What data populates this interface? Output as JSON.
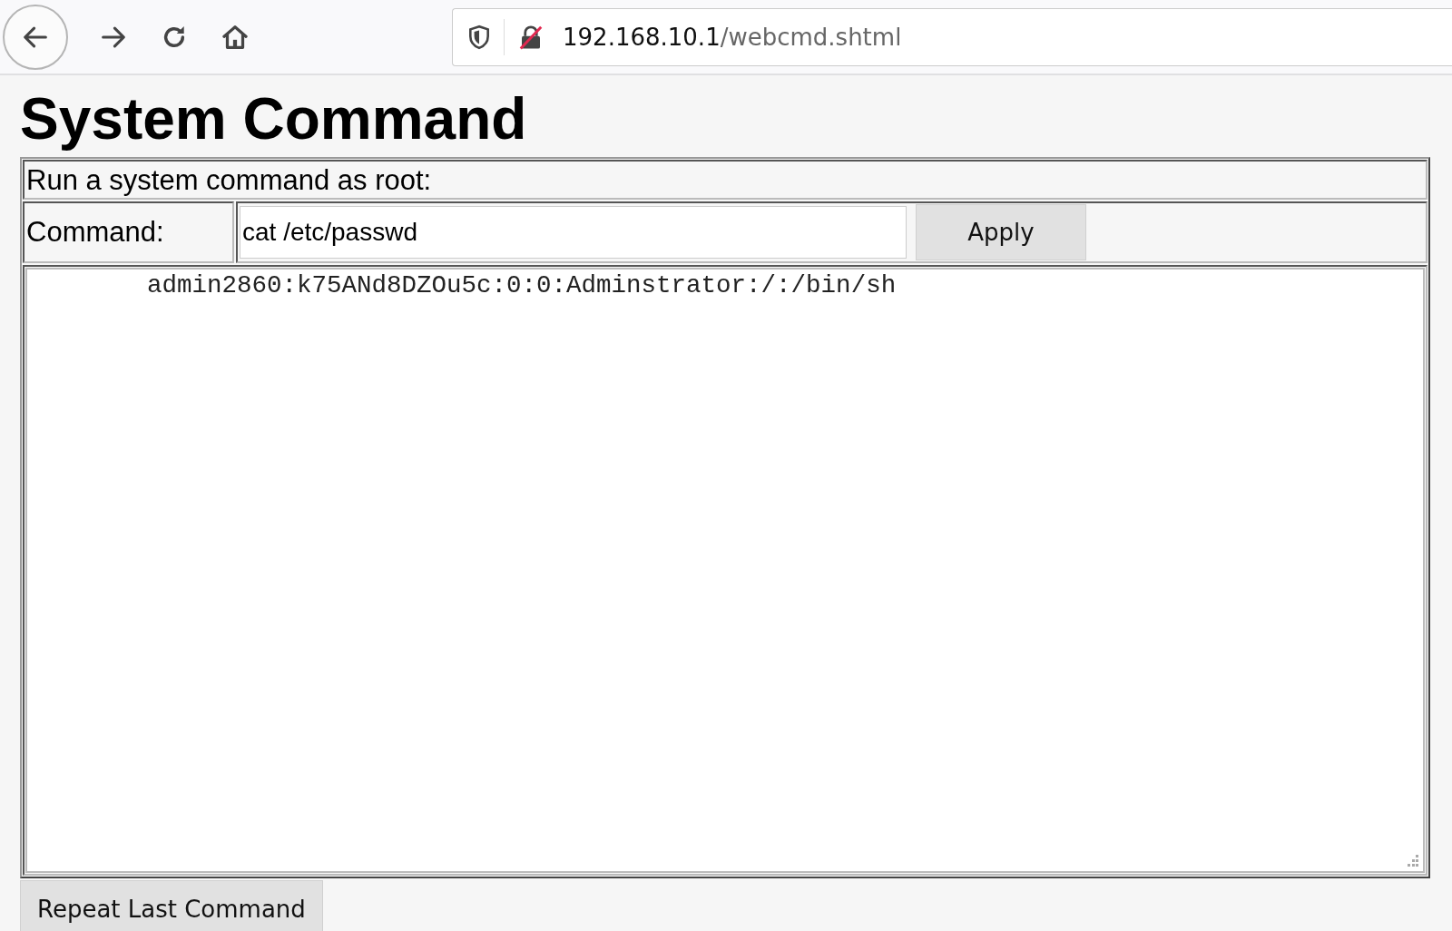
{
  "browser": {
    "url_host": "192.168.10.1",
    "url_path": "/webcmd.shtml"
  },
  "page": {
    "heading": "System Command",
    "intro": "Run a system command as root:",
    "command_label": "Command:",
    "command_value": "cat /etc/passwd",
    "apply_button": "Apply",
    "output": "admin2860:k75ANd8DZOu5c:0:0:Adminstrator:/:/bin/sh",
    "repeat_button": "Repeat Last Command"
  }
}
